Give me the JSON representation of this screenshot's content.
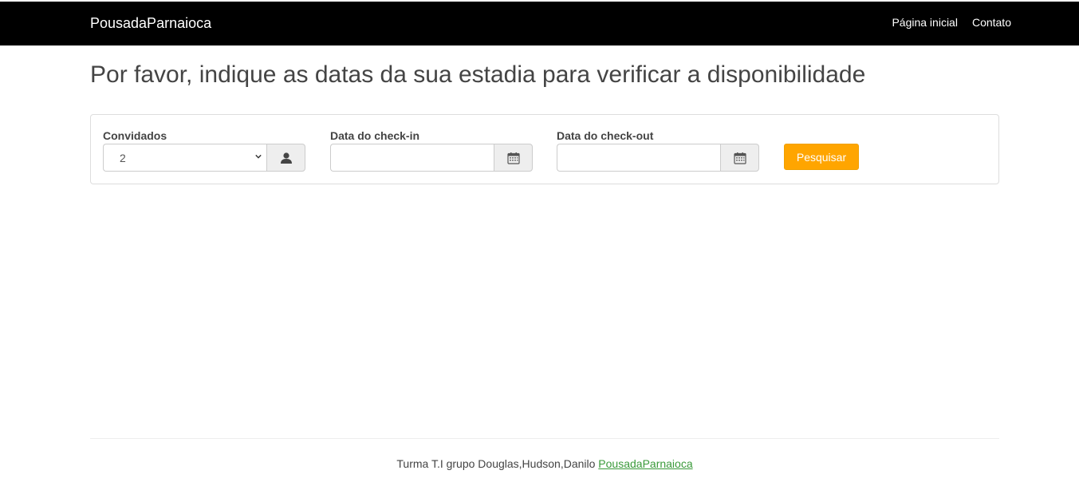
{
  "navbar": {
    "brand": "PousadaParnaioca",
    "links": [
      "Página inicial",
      "Contato"
    ]
  },
  "main": {
    "title": "Por favor, indique as datas da sua estadia para verificar a disponibilidade"
  },
  "search": {
    "guests_label": "Convidados",
    "guests_value": "2",
    "checkin_label": "Data do check-in",
    "checkin_value": "",
    "checkout_label": "Data do check-out",
    "checkout_value": "",
    "submit_label": "Pesquisar",
    "icons": {
      "guests": "user-icon",
      "checkin": "calendar-icon",
      "checkout": "calendar-icon"
    }
  },
  "footer": {
    "text": "Turma T.I grupo Douglas,Hudson,Danilo",
    "link": "PousadaParnaioca"
  },
  "colors": {
    "navbar_bg": "#000000",
    "accent_button": "#ffa500",
    "footer_link": "#3a9a3a"
  }
}
